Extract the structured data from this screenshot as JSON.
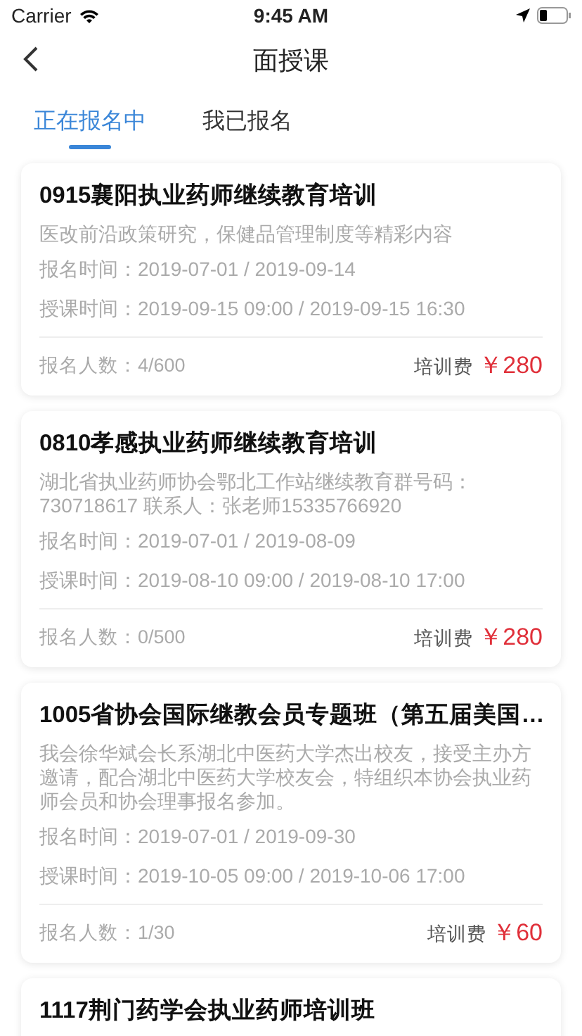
{
  "status_bar": {
    "carrier": "Carrier",
    "time": "9:45 AM"
  },
  "nav": {
    "title": "面授课"
  },
  "tabs": [
    {
      "label": "正在报名中",
      "selected": true
    },
    {
      "label": "我已报名",
      "selected": false
    }
  ],
  "courses": [
    {
      "title": "0915襄阳执业药师继续教育培训",
      "description": "医改前沿政策研究，保健品管理制度等精彩内容",
      "signup_time": "报名时间：2019-07-01 / 2019-09-14",
      "class_time": "授课时间：2019-09-15 09:00 / 2019-09-15 16:30",
      "enrollment": "报名人数：4/600",
      "fee_label": "培训费",
      "price": "￥280"
    },
    {
      "title": "0810孝感执业药师继续教育培训",
      "description": "湖北省执业药师协会鄂北工作站继续教育群号码：730718617   联系人：张老师15335766920",
      "signup_time": "报名时间：2019-07-01 / 2019-08-09",
      "class_time": "授课时间：2019-08-10 09:00 / 2019-08-10 17:00",
      "enrollment": "报名人数：0/500",
      "fee_label": "培训费",
      "price": "￥280"
    },
    {
      "title": "1005省协会国际继教会员专题班（第五届美国…",
      "description": "我会徐华斌会长系湖北中医药大学杰出校友，接受主办方邀请，配合湖北中医药大学校友会，特组织本协会执业药师会员和协会理事报名参加。",
      "signup_time": "报名时间：2019-07-01 / 2019-09-30",
      "class_time": "授课时间：2019-10-05 09:00 / 2019-10-06 17:00",
      "enrollment": "报名人数：1/30",
      "fee_label": "培训费",
      "price": "￥60"
    },
    {
      "title": "1117荆门药学会执业药师培训班"
    }
  ]
}
